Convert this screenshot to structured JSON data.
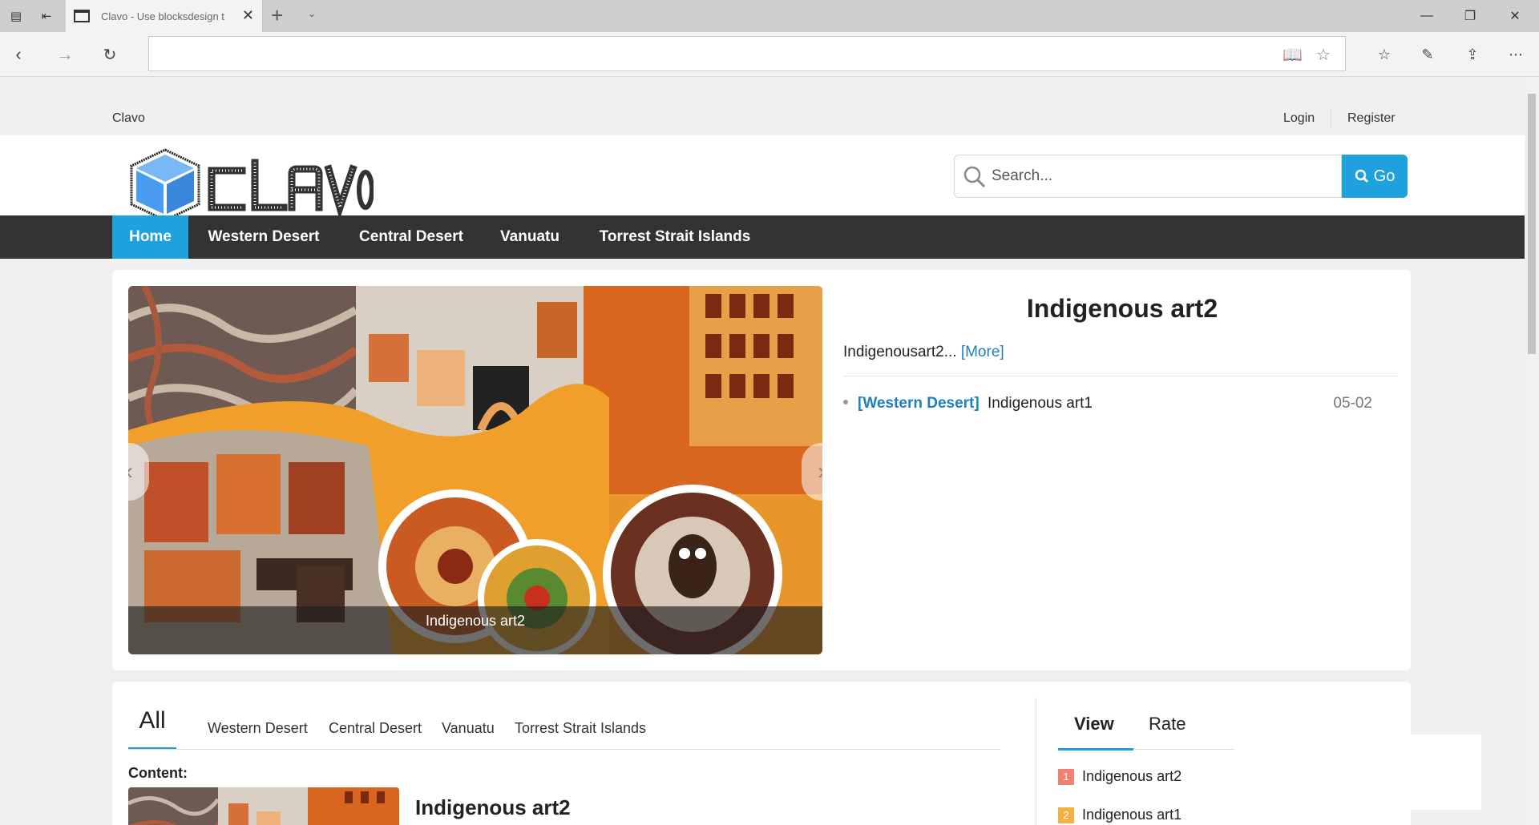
{
  "browser": {
    "tab_title": "Clavo - Use blocksdesign t",
    "address_value": "",
    "new_tab_glyph": "+",
    "close_glyph": "✕"
  },
  "site": {
    "name": "Clavo",
    "login": "Login",
    "register": "Register",
    "logo_text": "CLAVO"
  },
  "search": {
    "placeholder": "Search...",
    "go_label": "Go"
  },
  "nav": {
    "items": [
      {
        "label": "Home",
        "active": true
      },
      {
        "label": "Western Desert"
      },
      {
        "label": "Central Desert"
      },
      {
        "label": "Vanuatu"
      },
      {
        "label": "Torrest Strait Islands"
      }
    ]
  },
  "featured": {
    "caption": "Indigenous art2",
    "title": "Indigenous art2",
    "excerpt": "Indigenousart2...",
    "more": "[More]",
    "news": [
      {
        "category": "[Western Desert]",
        "title": "Indigenous art1",
        "date": "05-02"
      }
    ]
  },
  "content_tabs": {
    "all": "All",
    "categories": [
      "Western Desert",
      "Central Desert",
      "Vanuatu",
      "Torrest Strait Islands"
    ],
    "content_label": "Content:",
    "first_item_title": "Indigenous art2"
  },
  "ranking": {
    "view": "View",
    "rate": "Rate",
    "items": [
      {
        "num": "1",
        "title": "Indigenous art2",
        "color": "#f08070"
      },
      {
        "num": "2",
        "title": "Indigenous art1",
        "color": "#f5b042"
      }
    ]
  },
  "colors": {
    "accent": "#1ea1dc",
    "nav_bg": "#333333",
    "link": "#1f7fc0"
  }
}
